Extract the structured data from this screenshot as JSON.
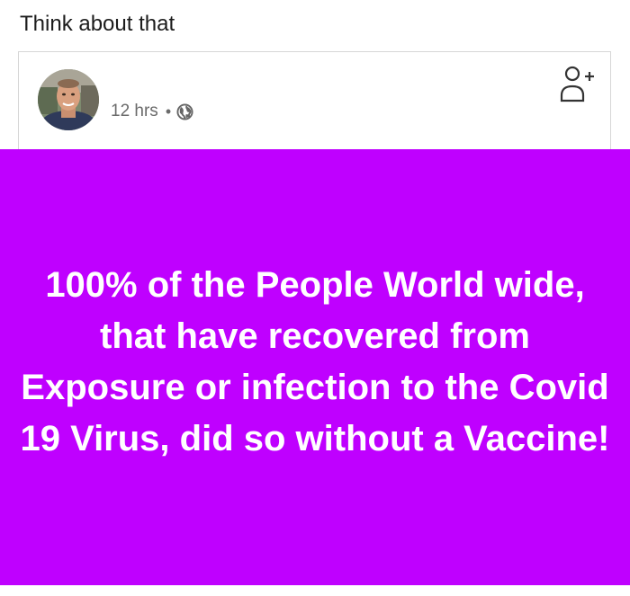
{
  "caption": "Think about that",
  "post": {
    "timestamp": "12 hrs",
    "separator": "•",
    "privacy_icon": "globe-icon",
    "add_friend_icon": "add-person-icon",
    "text": "100% of the People World wide, that have recovered from Exposure or infection to the Covid 19 Virus, did so without a Vaccine!",
    "background_color": "#bf00ff",
    "text_color": "#ffffff"
  }
}
